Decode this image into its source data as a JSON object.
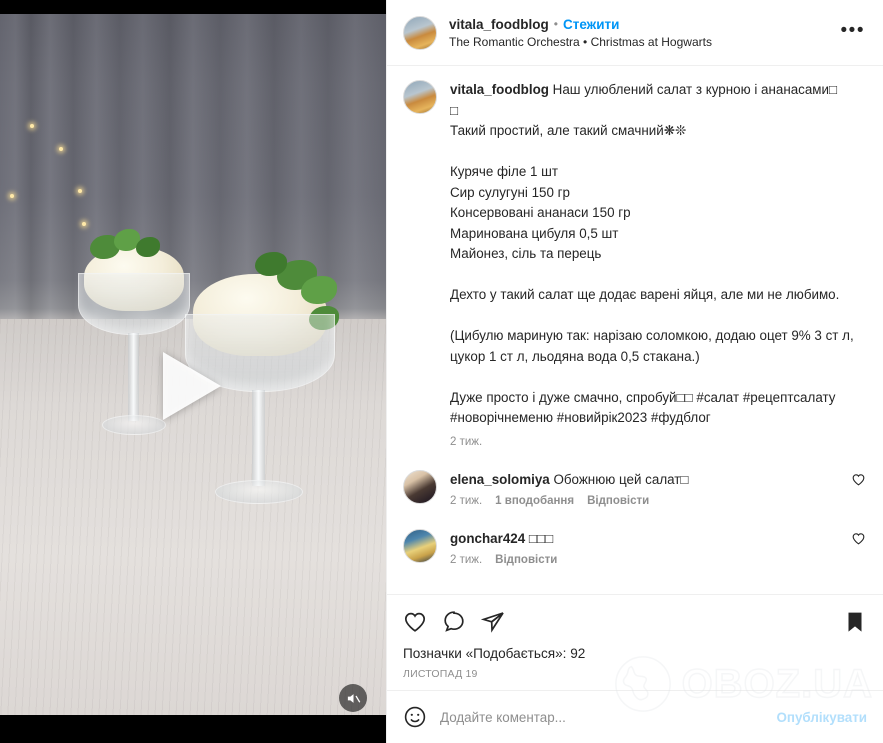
{
  "post": {
    "header": {
      "username": "vitala_foodblog",
      "separator": "•",
      "follow_label": "Стежити",
      "audio_label": "The Romantic Orchestra • Christmas at Hogwarts",
      "more_options": "•••"
    },
    "caption": {
      "username": "vitala_foodblog",
      "text": " Наш улюблений салат з курною і ананасами□\n□\nТакий простий, але такий смачний❋❊\n\nКуряче філе 1 шт\nСир сулугуні 150 гр\nКонсервовані ананаси 150 гр\nМаринована цибуля 0,5 шт\nМайонез, сіль та перець\n\nДехто у такий салат ще додає варені яйця, але ми не любимо.\n\n(Цибулю мариную так: нарізаю соломкою, додаю оцет 9% 3 ст л, цукор 1 ст л, льодяна вода 0,5 стакана.)\n\nДуже просто і дуже смачно, спробуй□□ #салат #рецептсалату #новорічнеменю #новийрік2023 #фудблог",
      "timeago": "2 тиж."
    },
    "comments": [
      {
        "username": "elena_solomiya",
        "text": " Обожнюю цей салат□",
        "timeago": "2 тиж.",
        "likes": "1 вподобання",
        "reply_label": "Відповісти"
      },
      {
        "username": "gonchar424",
        "text": " □□□",
        "timeago": "2 тиж.",
        "likes": "",
        "reply_label": "Відповісти"
      }
    ],
    "actions": {
      "like_icon": "heart-icon",
      "comment_icon": "comment-icon",
      "share_icon": "share-icon",
      "save_icon": "bookmark-icon-filled",
      "likes_text": "Позначки «Подобається»: 92",
      "date": "ЛИСТОПАД 19"
    },
    "add_comment": {
      "emoji_icon": "emoji-smiley-icon",
      "placeholder": "Додайте коментар...",
      "publish_label": "Опублікувати"
    }
  },
  "media": {
    "play_icon": "play-triangle-icon",
    "mute_icon": "speaker-muted-icon"
  },
  "watermark": {
    "text": "OBOZ.UA",
    "globe_icon": "globe-icon"
  },
  "colors": {
    "link": "#0095f6",
    "text": "#262626",
    "muted": "#8e8e8e",
    "divider": "#efefef",
    "publish_disabled": "#b2dffc"
  }
}
